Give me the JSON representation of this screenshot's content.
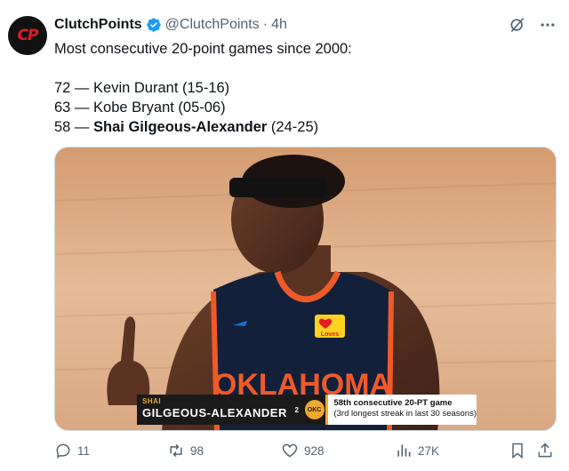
{
  "tweet": {
    "author_name": "ClutchPoints",
    "handle": "@ClutchPoints",
    "separator": "·",
    "time": "4h",
    "avatar_text": "CP",
    "lines": [
      "Most consecutive 20-point games since 2000:",
      "72 — Kevin Durant (15-16)",
      "63 — Kobe Bryant (05-06)"
    ],
    "line3_prefix": "58 — ",
    "line3_bold": "Shai Gilgeous-Alexander",
    "line3_suffix": " (24-25)"
  },
  "media": {
    "jersey_text": "OKLAHOMA",
    "patch_text": "Loves",
    "lower_third": {
      "first_name": "SHAI",
      "last_name": "GILGEOUS-ALEXANDER",
      "number": "2",
      "team_badge": "OKC",
      "stat_line1": "58th consecutive 20-PT game",
      "stat_line2": "(3rd longest streak in last 30 seasons)"
    }
  },
  "actions": {
    "replies": "11",
    "reposts": "98",
    "likes": "928",
    "views": "27K"
  },
  "icons": {
    "grok": "grok-icon",
    "more": "more-icon",
    "reply": "reply-icon",
    "repost": "repost-icon",
    "like": "heart-icon",
    "views": "views-icon",
    "bookmark": "bookmark-icon",
    "share": "share-icon"
  },
  "colors": {
    "text": "#0f1419",
    "secondary": "#536471",
    "verified": "#1d9bf0",
    "brand_red": "#e31b23",
    "thunder_navy": "#12203a",
    "thunder_orange": "#f05a28"
  }
}
